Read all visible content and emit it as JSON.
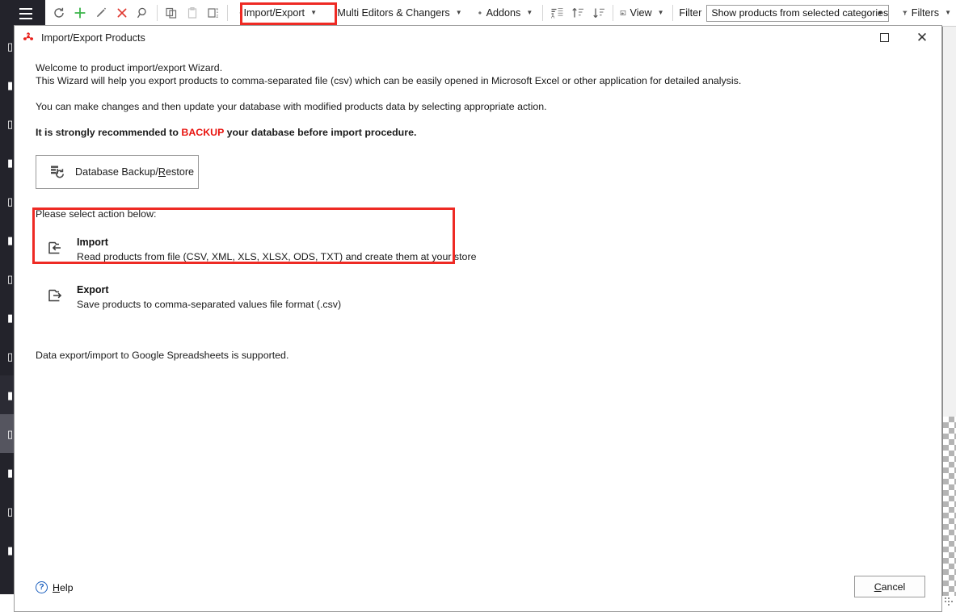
{
  "toolbar": {
    "menu_icon": "hamburger-icon",
    "buttons": [
      {
        "name": "refresh",
        "icon": "refresh-icon",
        "label": ""
      },
      {
        "name": "add",
        "icon": "plus-icon",
        "label": ""
      },
      {
        "name": "edit",
        "icon": "pencil-icon",
        "label": ""
      },
      {
        "name": "delete",
        "icon": "close-x-icon",
        "label": ""
      },
      {
        "name": "search",
        "icon": "magnifier-icon",
        "label": ""
      },
      {
        "name": "copy",
        "icon": "copy-icon",
        "label": ""
      },
      {
        "name": "paste",
        "icon": "clipboard-icon",
        "label": ""
      },
      {
        "name": "duplicate",
        "icon": "duplicate-icon",
        "label": ""
      }
    ],
    "import_export_label": "Import/Export",
    "multi_editors_label": "Multi Editors & Changers",
    "addons_label": "Addons",
    "view_label": "View",
    "filter_label": "Filter",
    "filter_value": "Show products from selected categories",
    "filters_label": "Filters",
    "highlight_color": "#ee2a24"
  },
  "dialog": {
    "title": "Import/Export Products",
    "app_icon": "tripod-app-icon",
    "maximize_label": "□",
    "close_label": "✕",
    "intro_line1": "Welcome to product import/export Wizard.",
    "intro_line2": "This Wizard will help you export products to comma-separated file (csv) which can be easily opened in Microsoft Excel or other application for detailed analysis.",
    "intro_line3": "You can make changes and then update your database with modified products data by selecting appropriate action.",
    "recommend_prefix": "It is strongly recommended to ",
    "recommend_backup": "BACKUP",
    "recommend_suffix": " your database before import procedure.",
    "backup_button_label": "Database Backup/Restore",
    "backup_button_accesskey": "R",
    "select_action_label": "Please select action below:",
    "actions": [
      {
        "name": "import",
        "icon": "folder-import-icon",
        "title": "Import",
        "description": "Read products from file (CSV, XML, XLS, XLSX, ODS, TXT) and create them at your store",
        "highlighted": true
      },
      {
        "name": "export",
        "icon": "folder-export-icon",
        "title": "Export",
        "description": "Save products to comma-separated values file format (.csv)",
        "highlighted": false
      }
    ],
    "google_note": "Data export/import to Google Spreadsheets is supported.",
    "help_label": "Help",
    "help_icon": "question-mark-icon",
    "cancel_label": "Cancel",
    "cancel_accesskey": "C"
  },
  "sidebar": {
    "items": [
      {
        "name": "sidebar-item-1",
        "glyph": "▯",
        "state": "normal"
      },
      {
        "name": "sidebar-item-2",
        "glyph": "▮",
        "state": "normal"
      },
      {
        "name": "sidebar-item-3",
        "glyph": "▯",
        "state": "normal"
      },
      {
        "name": "sidebar-item-4",
        "glyph": "▮",
        "state": "normal"
      },
      {
        "name": "sidebar-item-5",
        "glyph": "▯",
        "state": "normal"
      },
      {
        "name": "sidebar-item-6",
        "glyph": "▮",
        "state": "normal"
      },
      {
        "name": "sidebar-item-7",
        "glyph": "▯",
        "state": "normal"
      },
      {
        "name": "sidebar-item-8",
        "glyph": "▮",
        "state": "normal"
      },
      {
        "name": "sidebar-item-9",
        "glyph": "▯",
        "state": "normal"
      },
      {
        "name": "sidebar-item-10",
        "glyph": "▮",
        "state": "dim"
      },
      {
        "name": "sidebar-item-11",
        "glyph": "▯",
        "state": "selected"
      },
      {
        "name": "sidebar-item-12",
        "glyph": "▮",
        "state": "normal"
      },
      {
        "name": "sidebar-item-13",
        "glyph": "▯",
        "state": "normal"
      },
      {
        "name": "sidebar-item-14",
        "glyph": "▮",
        "state": "normal"
      }
    ]
  },
  "colors": {
    "sidebar_bg": "#23232b",
    "sidebar_selected": "#55555f",
    "accent_red": "#ee2a24",
    "link_blue": "#1b5fbe",
    "add_green": "#3bb54a",
    "delete_red": "#e03a32"
  }
}
